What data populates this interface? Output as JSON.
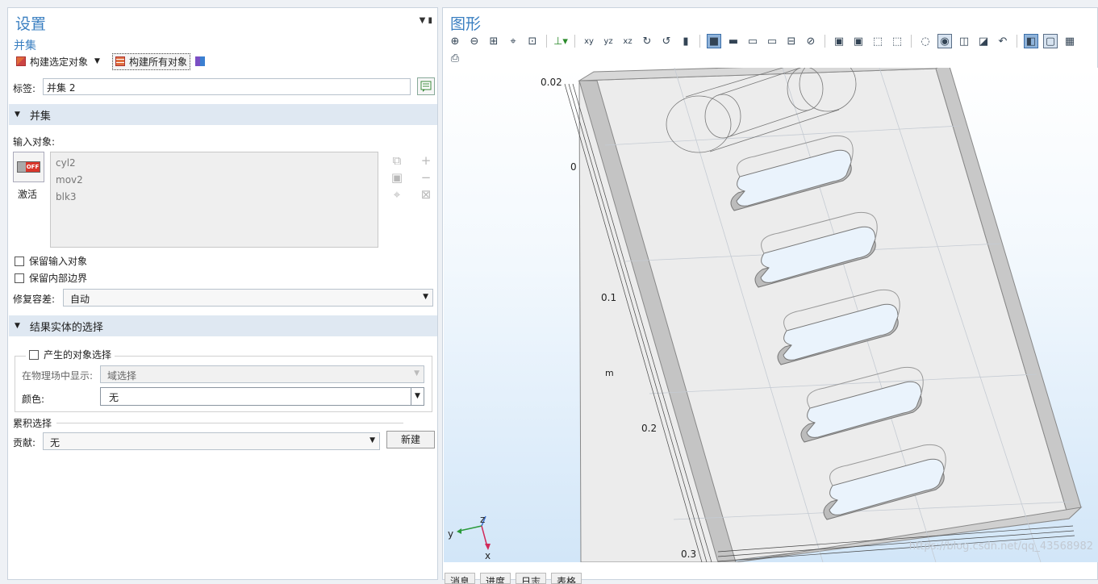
{
  "settings": {
    "title": "设置",
    "subtitle": "并集",
    "build_selected": "构建选定对象",
    "build_all": "构建所有对象",
    "label_caption": "标签:",
    "label_value": "并集 2",
    "section_union": "并集",
    "input_objects_caption": "输入对象:",
    "toggle_state": "OFF",
    "activate_label": "激活",
    "input_objects": [
      "cyl2",
      "mov2",
      "blk3"
    ],
    "keep_input": "保留输入对象",
    "keep_interior": "保留内部边界",
    "repair_tolerance_caption": "修复容差:",
    "repair_tolerance_value": "自动",
    "section_result": "结果实体的选择",
    "resulting_selection": "产生的对象选择",
    "show_in_physics_caption": "在物理场中显示:",
    "show_in_physics_value": "域选择",
    "color_caption": "颜色:",
    "color_value": "无",
    "cumulative_caption": "累积选择",
    "contribute_caption": "贡献:",
    "contribute_value": "无",
    "new_button": "新建"
  },
  "graphics": {
    "title": "图形",
    "toolbar_icons": [
      "zoom-in-icon",
      "zoom-out-icon",
      "zoom-box-icon",
      "zoom-selected-icon",
      "zoom-extents-icon",
      "axes-orient-icon",
      "view-xy-icon",
      "view-yz-icon",
      "view-xz-icon",
      "rotate-cw-icon",
      "rotate-ccw-icon",
      "transparency-icon",
      "select-domain-icon",
      "select-boundary-icon",
      "select-edge-icon",
      "select-point-icon",
      "clear-selection-icon",
      "image-snapshot-icon",
      "copy-image-icon",
      "select-box-icon",
      "deselect-box-icon",
      "hide-icon",
      "show-icon",
      "wireframe-icon",
      "scene-light-icon",
      "reset-icon",
      "view-mode-a-icon",
      "view-mode-b-icon",
      "grid-icon",
      "print-icon"
    ],
    "axis_ticks": [
      "0.02",
      "0",
      "0.1",
      "0.2",
      "0.3"
    ],
    "axis_unit": "m",
    "triad": {
      "z": "z",
      "y": "y",
      "x": "x"
    },
    "bottom_tabs": [
      "消息",
      "进度",
      "日志",
      "表格"
    ],
    "watermark": "https://blog.csdn.net/qq_43568982"
  },
  "colors": {
    "accent_blue": "#3a7fc1",
    "section_header": "#dfe8f2",
    "off_red": "#d9362b"
  }
}
